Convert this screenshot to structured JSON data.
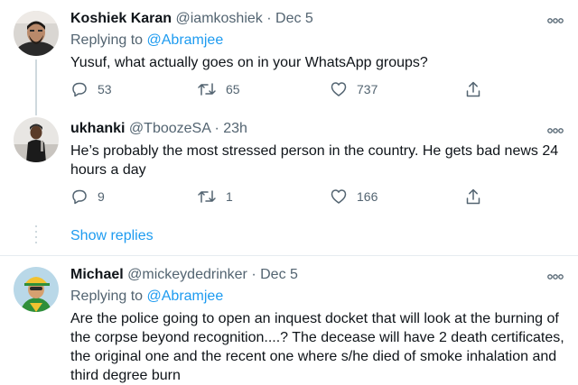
{
  "tweets": [
    {
      "name": "Koshiek Karan",
      "handle": "@iamkoshiek",
      "dot": "·",
      "time": "Dec 5",
      "replying_prefix": "Replying to ",
      "replying_to": "@Abramjee",
      "text": "Yusuf, what actually goes on in your WhatsApp groups?",
      "replies": "53",
      "retweets": "65",
      "likes": "737"
    },
    {
      "name": "ukhanki",
      "handle": "@TboozeSA",
      "dot": "·",
      "time": "23h",
      "text": "He’s probably the most stressed person in the country. He gets bad news 24 hours a day",
      "replies": "9",
      "retweets": "1",
      "likes": "166"
    },
    {
      "name": "Michael",
      "handle": "@mickeydedrinker",
      "dot": "·",
      "time": "Dec 5",
      "replying_prefix": "Replying to ",
      "replying_to": "@Abramjee",
      "text": "Are the police going to open an inquest docket that will look at the burning of the corpse beyond recognition....? The decease will have 2 death certificates, the original one and the recent one where s/he died of smoke inhalation and third degree burn"
    }
  ],
  "show_replies": "Show replies",
  "icons": {
    "reply": "reply-icon",
    "retweet": "retweet-icon",
    "like": "heart-icon",
    "share": "share-icon",
    "more": "more-icon"
  },
  "colors": {
    "link": "#1d9bf0",
    "secondary": "#536471",
    "primary_text": "#0f1419",
    "divider": "#e6ecf0"
  }
}
